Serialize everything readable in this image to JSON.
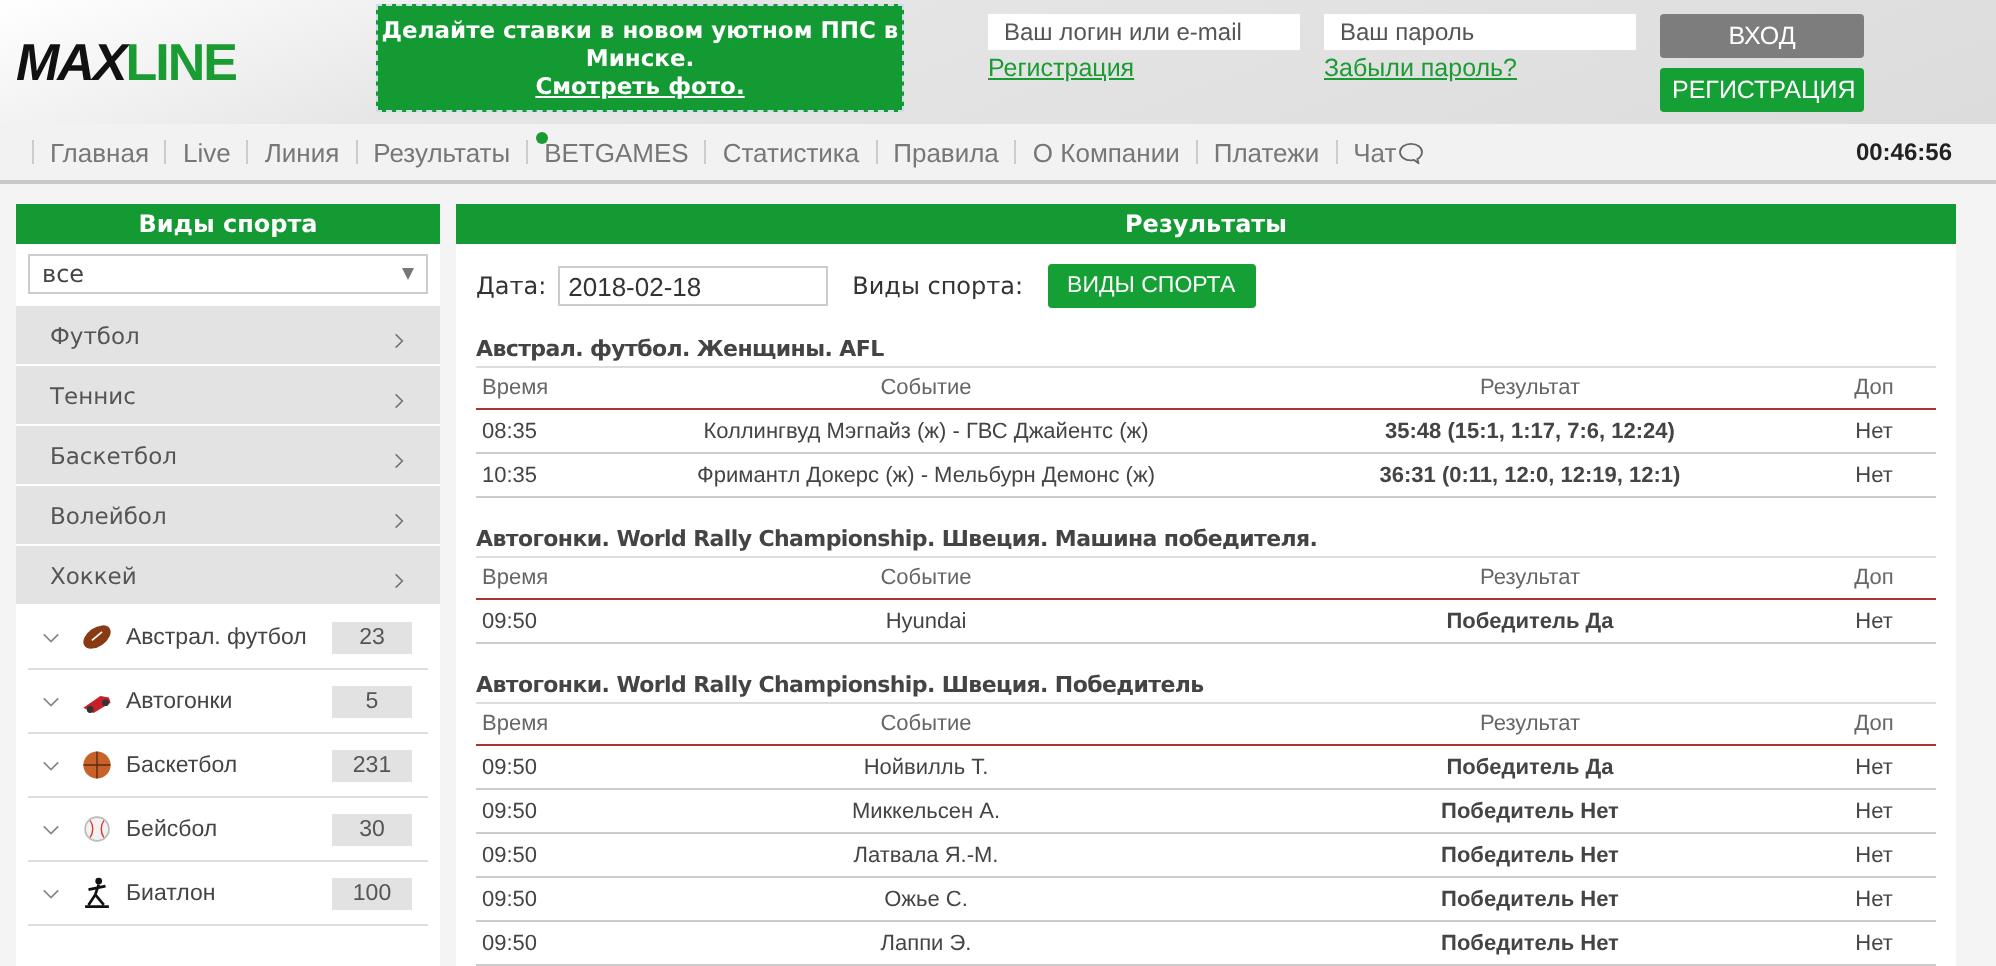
{
  "logo": {
    "part1": "MAX",
    "part2": "LINE"
  },
  "promo": {
    "text": "Делайте ставки в новом уютном ППС в Минске.",
    "link": "Смотреть фото."
  },
  "login": {
    "login_placeholder": "Ваш логин или e-mail",
    "password_placeholder": "Ваш пароль",
    "register_link": "Регистрация",
    "forgot_link": "Забыли пароль?",
    "login_button": "ВХОД",
    "register_button": "РЕГИСТРАЦИЯ"
  },
  "nav": [
    {
      "label": "Главная",
      "kind": "plain"
    },
    {
      "label": "Live",
      "kind": "plain"
    },
    {
      "label": "Линия",
      "kind": "plain"
    },
    {
      "label": "Результаты",
      "kind": "plain"
    },
    {
      "label": "BETGAMES",
      "kind": "dot"
    },
    {
      "label": "Статистика",
      "kind": "plain"
    },
    {
      "label": "Правила",
      "kind": "plain"
    },
    {
      "label": "О Компании",
      "kind": "plain"
    },
    {
      "label": "Платежи",
      "kind": "plain"
    },
    {
      "label": "Чат",
      "kind": "chat"
    }
  ],
  "clock": "00:46:56",
  "sidebar": {
    "title": "Виды спорта",
    "filter_value": "все",
    "categories": [
      "Футбол",
      "Теннис",
      "Баскетбол",
      "Волейбол",
      "Хоккей"
    ],
    "sports": [
      {
        "name": "Австрал. футбол",
        "count": "23",
        "kind": "oval-ball"
      },
      {
        "name": "Автогонки",
        "count": "5",
        "kind": "car"
      },
      {
        "name": "Баскетбол",
        "count": "231",
        "kind": "basketball"
      },
      {
        "name": "Бейсбол",
        "count": "30",
        "kind": "baseball"
      },
      {
        "name": "Биатлон",
        "count": "100",
        "kind": "biathlon"
      }
    ]
  },
  "results": {
    "title": "Результаты",
    "date_label": "Дата:",
    "date_value": "2018-02-18",
    "sports_label": "Виды спорта:",
    "sports_button": "ВИДЫ СПОРТА",
    "sections": [
      {
        "title": "Австрал. футбол. Женщины. AFL",
        "columns": [
          "Время",
          "Событие",
          "Результат",
          "Доп"
        ],
        "rows": [
          [
            "08:35",
            "Коллингвуд Мэгпайз (ж) - ГВС Джайентс (ж)",
            "35:48 (15:1, 1:17, 7:6, 12:24)",
            "Нет"
          ],
          [
            "10:35",
            "Фримантл Докерс (ж) - Мельбурн Демонс (ж)",
            "36:31 (0:11, 12:0, 12:19, 12:1)",
            "Нет"
          ]
        ]
      },
      {
        "title": "Автогонки. World Rally Championship. Швеция. Машина победителя.",
        "columns": [
          "Время",
          "Событие",
          "Результат",
          "Доп"
        ],
        "rows": [
          [
            "09:50",
            "Hyundai",
            "Победитель Да",
            "Нет"
          ]
        ]
      },
      {
        "title": "Автогонки. World Rally Championship. Швеция. Победитель",
        "columns": [
          "Время",
          "Событие",
          "Результат",
          "Доп"
        ],
        "rows": [
          [
            "09:50",
            "Нойвилль Т.",
            "Победитель Да",
            "Нет"
          ],
          [
            "09:50",
            "Миккельсен А.",
            "Победитель Нет",
            "Нет"
          ],
          [
            "09:50",
            "Латвала Я.-М.",
            "Победитель Нет",
            "Нет"
          ],
          [
            "09:50",
            "Ожье С.",
            "Победитель Нет",
            "Нет"
          ],
          [
            "09:50",
            "Лаппи Э.",
            "Победитель Нет",
            "Нет"
          ]
        ]
      }
    ]
  }
}
